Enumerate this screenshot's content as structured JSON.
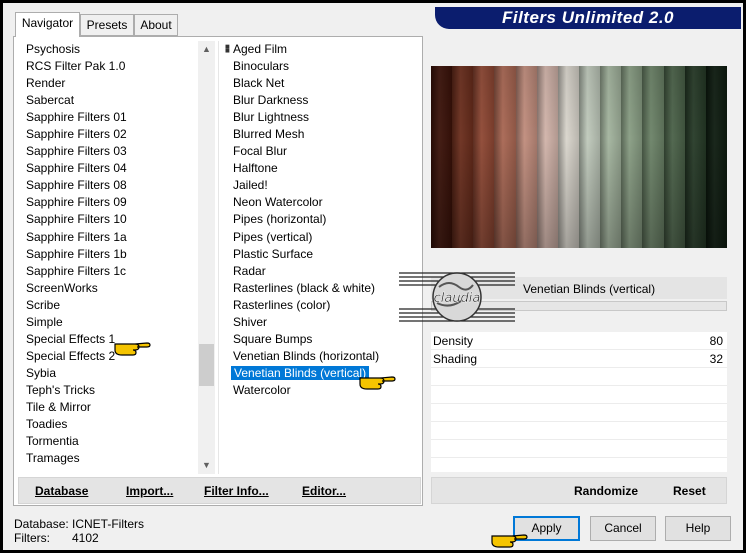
{
  "window": {
    "title": "Filters Unlimited 2.0"
  },
  "tabs": [
    {
      "label": "Navigator",
      "active": true
    },
    {
      "label": "Presets",
      "active": false
    },
    {
      "label": "About",
      "active": false
    }
  ],
  "categories": {
    "items": [
      "Psychosis",
      "RCS Filter Pak 1.0",
      "Render",
      "Sabercat",
      "Sapphire Filters 01",
      "Sapphire Filters 02",
      "Sapphire Filters 03",
      "Sapphire Filters 04",
      "Sapphire Filters 08",
      "Sapphire Filters 09",
      "Sapphire Filters 10",
      "Sapphire Filters 1a",
      "Sapphire Filters 1b",
      "Sapphire Filters 1c",
      "ScreenWorks",
      "Scribe",
      "Simple",
      "Special Effects 1",
      "Special Effects 2",
      "Sybia",
      "Teph's Tricks",
      "Tile & Mirror",
      "Toadies",
      "Tormentia",
      "Tramages"
    ],
    "selected": "Special Effects 1",
    "scroll_position": 0.8
  },
  "filters": {
    "items": [
      "Aged Film",
      "Binoculars",
      "Black Net",
      "Blur Darkness",
      "Blur Lightness",
      "Blurred Mesh",
      "Focal Blur",
      "Halftone",
      "Jailed!",
      "Neon Watercolor",
      "Pipes (horizontal)",
      "Pipes (vertical)",
      "Plastic Surface",
      "Radar",
      "Rasterlines (black & white)",
      "Rasterlines (color)",
      "Shiver",
      "Square Bumps",
      "Venetian Blinds (horizontal)",
      "Venetian Blinds (vertical)",
      "Watercolor"
    ],
    "selected": "Venetian Blinds (vertical)"
  },
  "left_toolbar": {
    "database": "Database",
    "import": "Import...",
    "filter_info": "Filter Info...",
    "editor": "Editor..."
  },
  "preview": {
    "stripe_colors": [
      "#3b1209",
      "#6a2d1c",
      "#8e4733",
      "#a86652",
      "#c08c7c",
      "#d1b3a9",
      "#d9d5cc",
      "#bfc9bb",
      "#a3b49e",
      "#889d83",
      "#6b8267",
      "#4a6148",
      "#263a27",
      "#0e1c10"
    ]
  },
  "current_filter": {
    "name": "Venetian Blinds (vertical)",
    "params": [
      {
        "label": "Density",
        "value": "80"
      },
      {
        "label": "Shading",
        "value": "32"
      }
    ]
  },
  "right_toolbar": {
    "randomize": "Randomize",
    "reset": "Reset"
  },
  "status": {
    "database_label": "Database:",
    "database_value": "ICNET-Filters",
    "filters_label": "Filters:",
    "filters_value": "4102"
  },
  "buttons": {
    "apply": "Apply",
    "cancel": "Cancel",
    "help": "Help"
  },
  "watermark": {
    "text": "claudia"
  },
  "colors": {
    "selection": "#0078d7",
    "title_banner": "#0b1d6e",
    "hand": "#f5c400"
  }
}
